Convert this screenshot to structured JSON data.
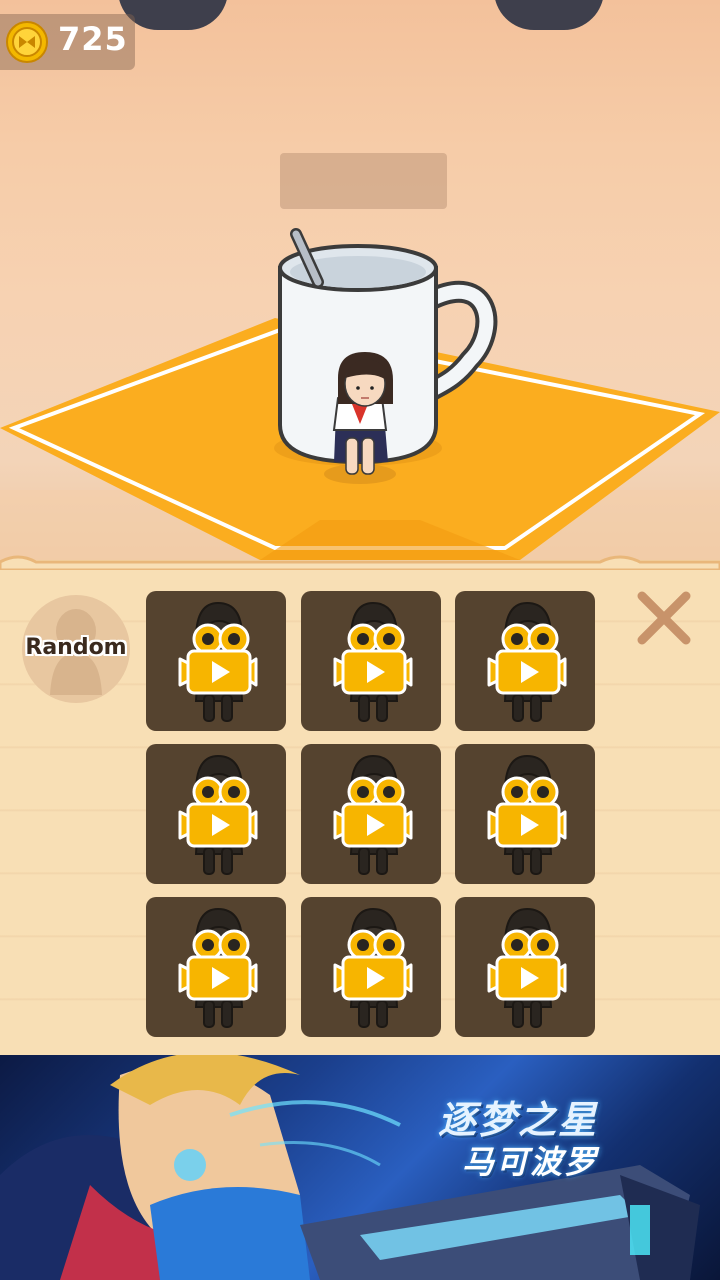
{
  "hud": {
    "coins": "725",
    "coin_icon": "coin-icon"
  },
  "panel": {
    "random_label": "Random",
    "close_icon": "close-x-icon",
    "slots": [
      {
        "state": "locked-video"
      },
      {
        "state": "locked-video"
      },
      {
        "state": "locked-video"
      },
      {
        "state": "locked-video"
      },
      {
        "state": "locked-video"
      },
      {
        "state": "locked-video"
      },
      {
        "state": "locked-video"
      },
      {
        "state": "locked-video"
      },
      {
        "state": "locked-video"
      }
    ]
  },
  "ad": {
    "title": "逐梦之星",
    "subtitle": "马可波罗"
  },
  "colors": {
    "tile": "#55432f",
    "camera": "#f7b500",
    "placemat": "#fbad1f",
    "panel": "#f8dfb5"
  }
}
